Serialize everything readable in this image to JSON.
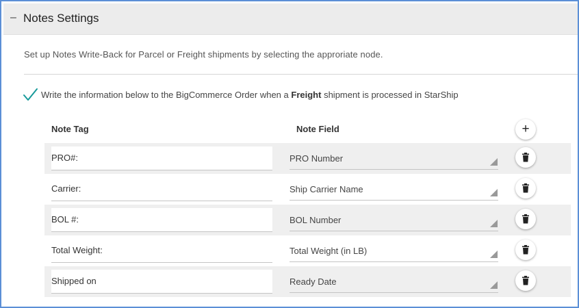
{
  "header": {
    "toggle_symbol": "–",
    "title": "Notes Settings"
  },
  "description": "Set up Notes Write-Back for Parcel or Freight shipments by selecting the approriate node.",
  "writeback": {
    "checked": true,
    "text_before": "Write the information below to the BigCommerce Order when a",
    "text_bold": "Freight",
    "text_after": "shipment is processed in StarShip"
  },
  "table": {
    "col_note_tag": "Note Tag",
    "col_note_field": "Note Field",
    "add_icon": "plus-icon",
    "delete_icon": "trash-icon",
    "rows": [
      {
        "tag": "PRO#:",
        "field": "PRO Number"
      },
      {
        "tag": "Carrier:",
        "field": "Ship Carrier Name"
      },
      {
        "tag": "BOL #:",
        "field": "BOL Number"
      },
      {
        "tag": "Total Weight:",
        "field": "Total Weight (in LB)"
      },
      {
        "tag": "Shipped on",
        "field": "Ready Date"
      }
    ]
  },
  "colors": {
    "frame_border": "#5b8fd6",
    "check_accent": "#179a9a",
    "header_bg": "#ececec",
    "row_stripe": "#efefef"
  }
}
